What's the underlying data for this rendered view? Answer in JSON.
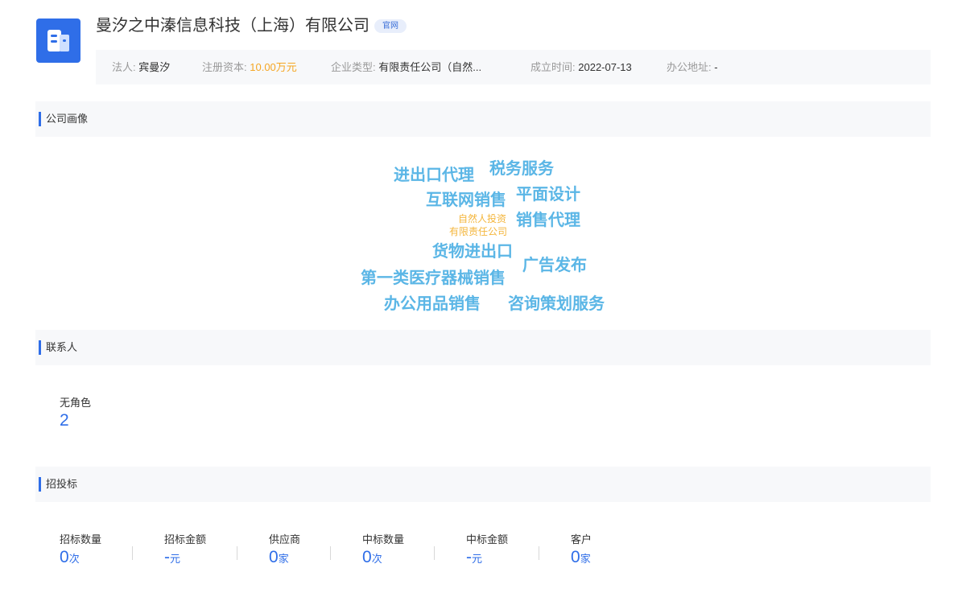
{
  "company": {
    "name": "曼汐之中溱信息科技（上海）有限公司",
    "official_site_tag": "官网",
    "logo_icon": "building-icon",
    "brand_color": "#2f6ee8"
  },
  "info": {
    "legal_person_label": "法人:",
    "legal_person": "宾曼汐",
    "capital_label": "注册资本:",
    "capital": "10.00万元",
    "type_label": "企业类型:",
    "type": "有限责任公司（自然...",
    "established_label": "成立时间:",
    "established": "2022-07-13",
    "address_label": "办公地址:",
    "address": "-"
  },
  "profile": {
    "title": "公司画像",
    "words": [
      "进出口代理",
      "税务服务",
      "互联网销售",
      "平面设计",
      "自然人投资",
      "销售代理",
      "有限责任公司",
      "货物进出口",
      "第一类医疗器械销售",
      "广告发布",
      "办公用品销售",
      "咨询策划服务"
    ]
  },
  "contacts": {
    "title": "联系人",
    "role_label": "无角色",
    "role_count": "2"
  },
  "bidding": {
    "title": "招投标",
    "stats": [
      {
        "label": "招标数量",
        "value": "0",
        "unit": "次"
      },
      {
        "label": "招标金额",
        "value": "-",
        "unit": "元"
      },
      {
        "label": "供应商",
        "value": "0",
        "unit": "家"
      },
      {
        "label": "中标数量",
        "value": "0",
        "unit": "次"
      },
      {
        "label": "中标金额",
        "value": "-",
        "unit": "元"
      },
      {
        "label": "客户",
        "value": "0",
        "unit": "家"
      }
    ]
  }
}
